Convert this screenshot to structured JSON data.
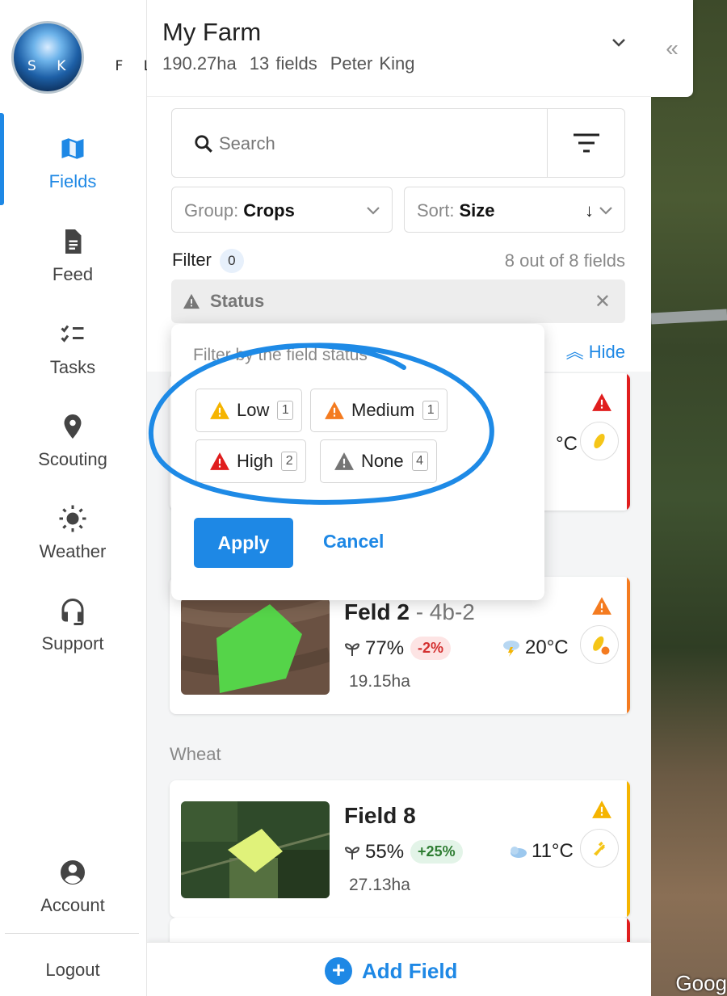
{
  "brand": {
    "logo_letters": "S K Y",
    "logo_letters_dark": "F L D"
  },
  "nav": {
    "items": [
      {
        "label": "Fields",
        "icon": "map-icon"
      },
      {
        "label": "Feed",
        "icon": "document-icon"
      },
      {
        "label": "Tasks",
        "icon": "checklist-icon"
      },
      {
        "label": "Scouting",
        "icon": "location-pin-icon"
      },
      {
        "label": "Weather",
        "icon": "sun-icon"
      },
      {
        "label": "Support",
        "icon": "headset-icon"
      }
    ],
    "account_label": "Account",
    "logout_label": "Logout",
    "active": "Fields"
  },
  "farm": {
    "title": "My Farm",
    "area": "190.27ha",
    "fields": "13 fields",
    "owner": "Peter King"
  },
  "search": {
    "placeholder": "Search"
  },
  "group": {
    "label": "Group:",
    "value": "Crops"
  },
  "sort": {
    "label": "Sort:",
    "value": "Size",
    "direction_glyph": "↓"
  },
  "filter": {
    "label": "Filter",
    "count": "0",
    "field_count_text": "8 out of 8 fields",
    "status_label": "Status",
    "hide_label": "Hide"
  },
  "popover": {
    "title": "Filter by the field status",
    "options": [
      {
        "label": "Low",
        "count": "1",
        "color": "#f5b400"
      },
      {
        "label": "Medium",
        "count": "1",
        "color": "#f47b20"
      },
      {
        "label": "High",
        "count": "2",
        "color": "#e01e1e"
      },
      {
        "label": "None",
        "count": "4",
        "color": "#757575"
      }
    ],
    "apply_label": "Apply",
    "cancel_label": "Cancel"
  },
  "cards": [
    {
      "name": "",
      "temp": "°C",
      "status_color": "#e01e1e",
      "crop_icon": "corn-icon"
    },
    {
      "name": "Feld 2",
      "sub": " - 4b-2",
      "ndvi": "77%",
      "change": "-2%",
      "change_type": "neg",
      "temp": "20°C",
      "area": "19.15ha",
      "status_color": "#f47b20",
      "crop_icon": "corn-icon"
    },
    {
      "name": "Field 8",
      "sub": "",
      "ndvi": "55%",
      "change": "+25%",
      "change_type": "pos",
      "temp": "11°C",
      "area": "27.13ha",
      "status_color": "#f5b400",
      "crop_icon": "wheat-icon"
    }
  ],
  "groups": {
    "wheat": "Wheat"
  },
  "footer": {
    "add_label": "Add Field"
  },
  "map": {
    "watermark": "Goog"
  },
  "accent": "#1e88e5"
}
